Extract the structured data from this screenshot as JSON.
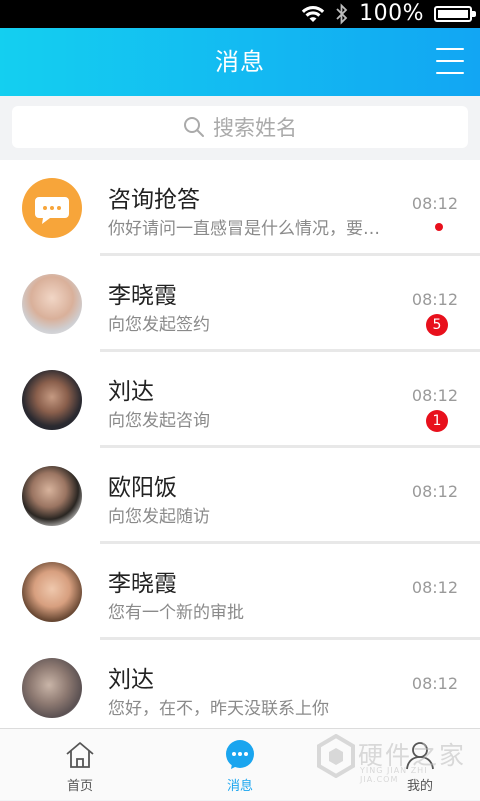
{
  "status_bar": {
    "battery_text": "100%"
  },
  "header": {
    "title": "消息"
  },
  "search": {
    "placeholder": "搜索姓名"
  },
  "conversations": [
    {
      "name": "咨询抢答",
      "preview": "你好请问一直感冒是什么情况，要…",
      "time": "08:12",
      "indicator": "dot"
    },
    {
      "name": "李晓霞",
      "preview": "向您发起签约",
      "time": "08:12",
      "badge": "5"
    },
    {
      "name": "刘达",
      "preview": "向您发起咨询",
      "time": "08:12",
      "badge": "1"
    },
    {
      "name": "欧阳饭",
      "preview": "向您发起随访",
      "time": "08:12"
    },
    {
      "name": "李晓霞",
      "preview": "您有一个新的审批",
      "time": "08:12"
    },
    {
      "name": "刘达",
      "preview": "您好，在不，昨天没联系上你",
      "time": "08:12"
    }
  ],
  "tabbar": {
    "home": "首页",
    "messages": "消息",
    "mine": "我的"
  },
  "watermark": {
    "text": "硬件之家",
    "sub": "YING JIAN ZHI JIA.COM"
  },
  "colors": {
    "accent": "#12a6f3",
    "badge": "#e8101c",
    "consult_icon": "#f7a53a"
  },
  "icons": [
    "wifi-icon",
    "bluetooth-icon",
    "battery-icon",
    "menu-icon",
    "search-icon",
    "chat-bubble-icon",
    "home-icon",
    "user-icon"
  ]
}
